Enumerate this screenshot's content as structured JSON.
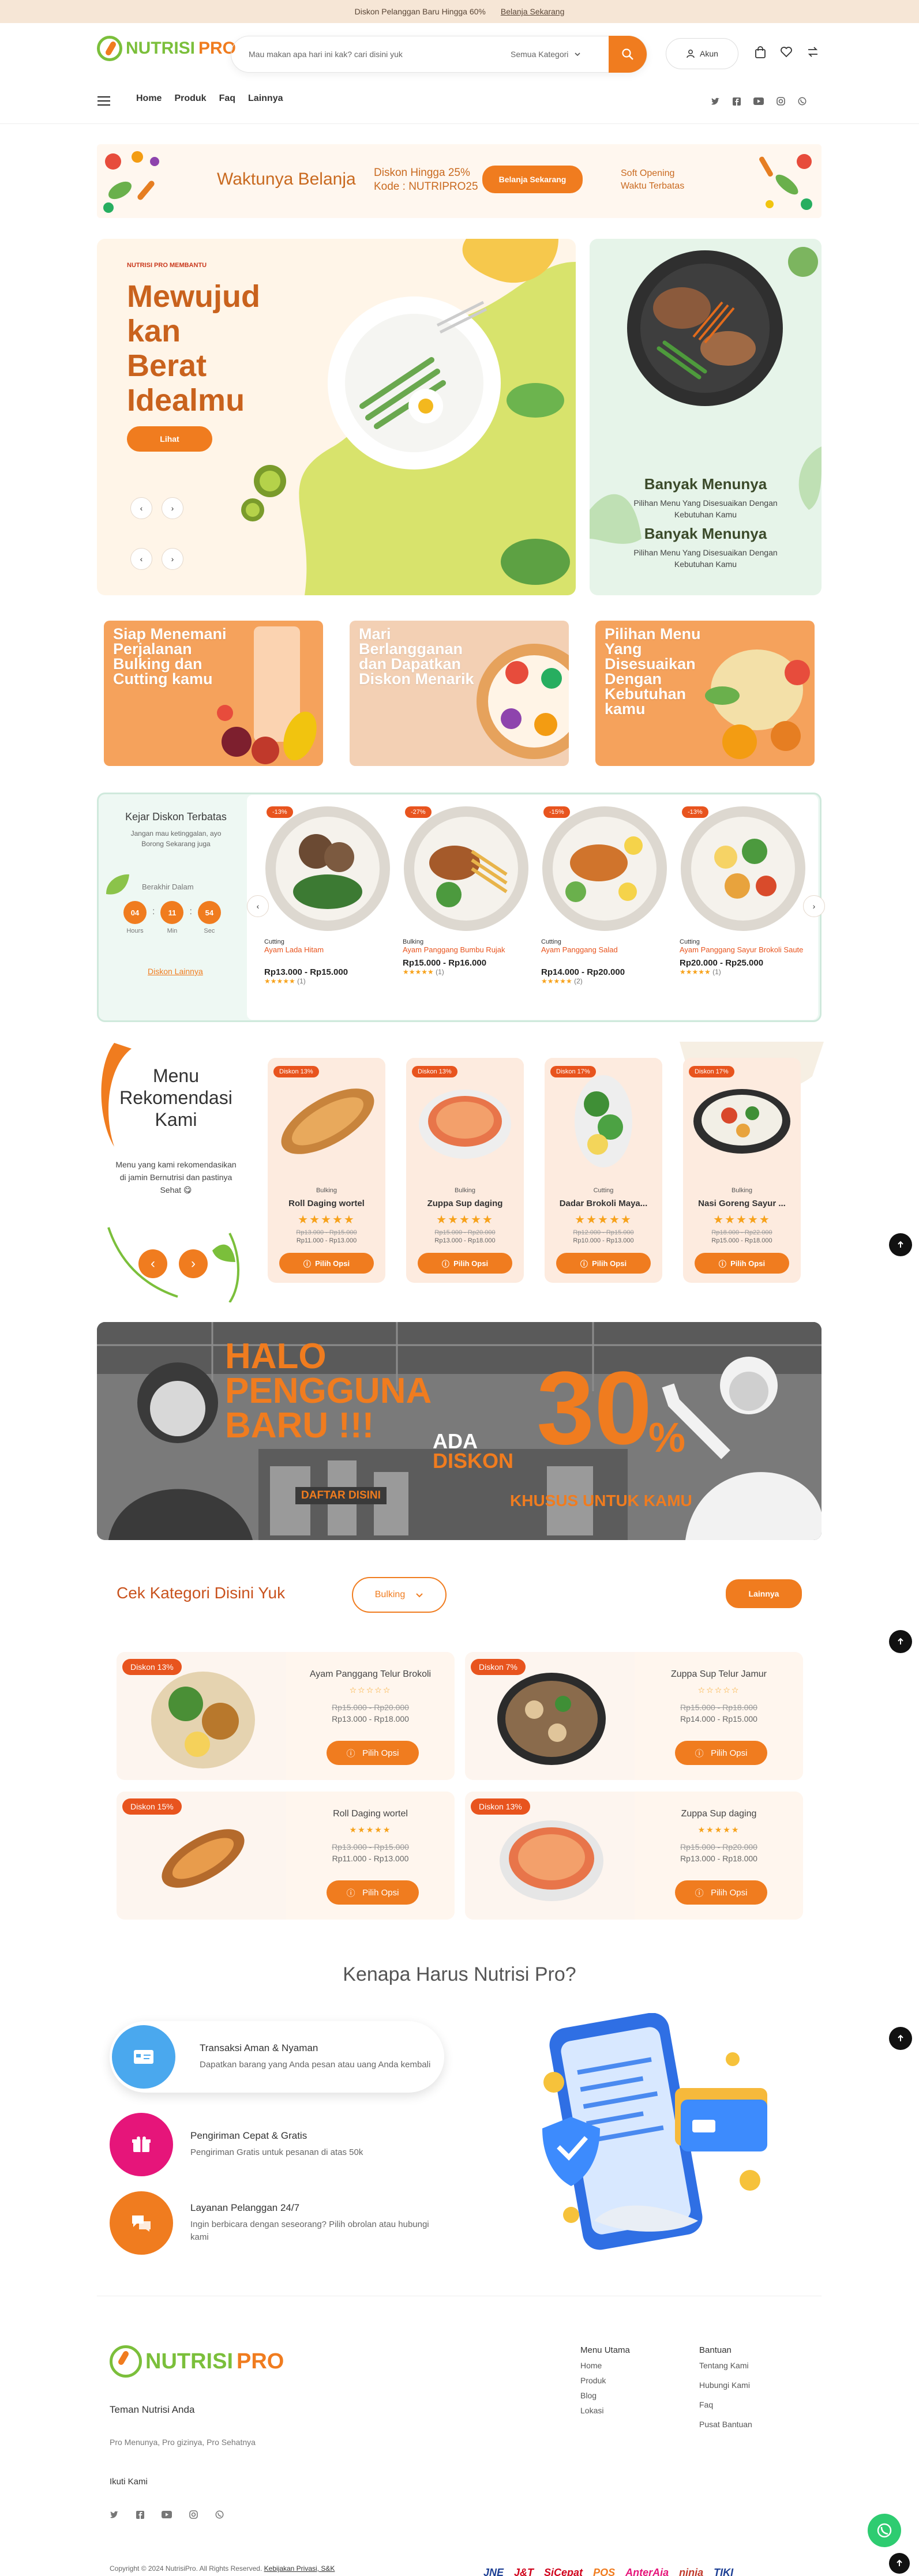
{
  "topbar": {
    "text": "Diskon Pelanggan Baru Hingga 60%",
    "link": "Belanja Sekarang"
  },
  "header": {
    "logo_nutri": "NUTRISI",
    "logo_pro": "PRO",
    "search_placeholder": "Mau makan apa hari ini kak? cari disini yuk",
    "category_select": "Semua Kategori",
    "account_label": "Akun",
    "nav": [
      "Home",
      "Produk",
      "Faq",
      "Lainnya"
    ]
  },
  "promo": {
    "title": "Waktunya Belanja",
    "discount_line1": "Diskon Hingga 25%",
    "discount_line2": "Kode : NUTRIPRO25",
    "button": "Belanja Sekarang",
    "soft_line1": "Soft Opening",
    "soft_line2": "Waktu Terbatas"
  },
  "hero": {
    "small": "NUTRISI PRO MEMBANTU",
    "line1": "Mewujud",
    "line2": "kan",
    "line3": "Berat",
    "line4": "Idealmu",
    "button": "Lihat"
  },
  "side": {
    "title1": "Banyak Menunya",
    "desc1": "Pilihan Menu Yang Disesuaikan Dengan Kebutuhan Kamu",
    "title2": "Banyak Menunya",
    "desc2": "Pilihan Menu Yang Disesuaikan Dengan Kebutuhan Kamu"
  },
  "cat_cards": [
    {
      "text": "Siap Menemani Perjalanan Bulking dan Cutting kamu"
    },
    {
      "text": "Mari Berlangganan dan Dapatkan Diskon Menarik"
    },
    {
      "text": "Pilihan Menu Yang Disesuaikan Dengan Kebutuhan kamu"
    }
  ],
  "flash": {
    "title": "Kejar Diskon Terbatas",
    "subtitle": "Jangan mau ketinggalan, ayo Borong Sekarang juga",
    "ends_label": "Berakhir Dalam",
    "timer": [
      {
        "v": "04",
        "l": "Hours"
      },
      {
        "v": "11",
        "l": "Min"
      },
      {
        "v": "54",
        "l": "Sec"
      }
    ],
    "link": "Diskon Lainnya",
    "products": [
      {
        "badge": "-13%",
        "type": "Cutting",
        "name": "Ayam Lada Hitam",
        "price": "Rp13.000 - Rp15.000",
        "reviews": "(1)"
      },
      {
        "badge": "-27%",
        "type": "Bulking",
        "name": "Ayam Panggang Bumbu Rujak",
        "price": "Rp15.000 - Rp16.000",
        "reviews": "(1)"
      },
      {
        "badge": "-15%",
        "type": "Cutting",
        "name": "Ayam Panggang Salad",
        "price": "Rp14.000 - Rp20.000",
        "reviews": "(2)"
      },
      {
        "badge": "-13%",
        "type": "Cutting",
        "name": "Ayam Panggang Sayur Brokoli Saute",
        "price": "Rp20.000 - Rp25.000",
        "reviews": "(1)"
      }
    ]
  },
  "rekomendasi": {
    "title": "Menu Rekomendasi Kami",
    "desc": "Menu yang kami rekomendasikan di jamin Bernutrisi dan pastinya Sehat 😋",
    "items": [
      {
        "badge": "Diskon 13%",
        "type": "Bulking",
        "name": "Roll Daging wortel",
        "old": "Rp13.000 - Rp15.000",
        "new": "Rp11.000 - Rp13.000",
        "button": "Pilih Opsi"
      },
      {
        "badge": "Diskon 13%",
        "type": "Bulking",
        "name": "Zuppa Sup daging",
        "old": "Rp15.000 - Rp20.000",
        "new": "Rp13.000 - Rp18.000",
        "button": "Pilih Opsi"
      },
      {
        "badge": "Diskon 17%",
        "type": "Cutting",
        "name": "Dadar Brokoli Maya...",
        "old": "Rp12.000 - Rp15.000",
        "new": "Rp10.000 - Rp13.000",
        "button": "Pilih Opsi"
      },
      {
        "badge": "Diskon 17%",
        "type": "Bulking",
        "name": "Nasi Goreng Sayur ...",
        "old": "Rp18.000 - Rp22.000",
        "new": "Rp15.000 - Rp18.000",
        "button": "Pilih Opsi"
      }
    ]
  },
  "banner": {
    "line1": "HALO",
    "line2": "PENGGUNA",
    "line3": "BARU !!!",
    "ada": "ADA",
    "diskon": "DISKON",
    "pct": "30",
    "pct_sign": "%",
    "khusus": "KHUSUS UNTUK KAMU",
    "daftar": "DAFTAR DISINI"
  },
  "kategori": {
    "title": "Cek Kategori Disini Yuk",
    "select": "Bulking",
    "button": "Lainnya",
    "items": [
      {
        "badge": "Diskon 13%",
        "name": "Ayam Panggang Telur Brokoli",
        "stars": "☆☆☆☆☆",
        "old": "Rp15.000 - Rp20.000",
        "new": "Rp13.000 - Rp18.000",
        "button": "Pilih Opsi"
      },
      {
        "badge": "Diskon 7%",
        "name": "Zuppa Sup Telur Jamur",
        "stars": "☆☆☆☆☆",
        "old": "Rp15.000 - Rp18.000",
        "new": "Rp14.000 - Rp15.000",
        "button": "Pilih Opsi"
      },
      {
        "badge": "Diskon 15%",
        "name": "Roll Daging wortel",
        "stars": "★★★★★",
        "old": "Rp13.000 - Rp15.000",
        "new": "Rp11.000 - Rp13.000",
        "button": "Pilih Opsi"
      },
      {
        "badge": "Diskon 13%",
        "name": "Zuppa Sup daging",
        "stars": "★★★★★",
        "old": "Rp15.000 - Rp20.000",
        "new": "Rp13.000 - Rp18.000",
        "button": "Pilih Opsi"
      }
    ]
  },
  "why": {
    "title": "Kenapa Harus Nutrisi Pro?",
    "items": [
      {
        "title": "Transaksi Aman & Nyaman",
        "desc": "Dapatkan barang yang Anda pesan atau uang Anda kembali",
        "color": "#4aa8ee"
      },
      {
        "title": "Pengiriman Cepat & Gratis",
        "desc": "Pengiriman Gratis untuk pesanan di atas 50k",
        "color": "#e6157a"
      },
      {
        "title": "Layanan Pelanggan 24/7",
        "desc": "Ingin berbicara dengan seseorang? Pilih obrolan atau hubungi kami",
        "color": "#f07c1f"
      }
    ]
  },
  "footer": {
    "tagline": "Teman Nutrisi Anda",
    "sub": "Pro Menunya, Pro gizinya, Pro Sehatnya",
    "follow": "Ikuti Kami",
    "menu_title": "Menu Utama",
    "menu": [
      "Home",
      "Produk",
      "Blog",
      "Lokasi"
    ],
    "help_title": "Bantuan",
    "help": [
      "Tentang Kami",
      "Hubungi Kami",
      "Faq",
      "Pusat Bantuan"
    ],
    "copyright": "Copyright © 2024 NutrisiPro. All Rights Reserved.",
    "privacy": "Kebijakan Privasi, S&K",
    "couriers": [
      "JNE",
      "J&T",
      "SiCepat",
      "POS",
      "AnterAja",
      "ninja",
      "TIKI"
    ]
  }
}
